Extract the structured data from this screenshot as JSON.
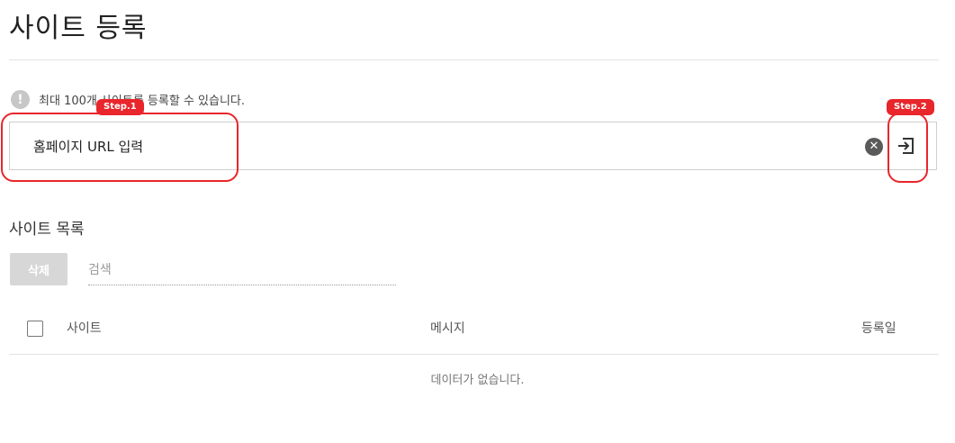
{
  "page": {
    "title": "사이트 등록"
  },
  "notice": {
    "text": "최대 100개 사이트를 등록할 수 있습니다."
  },
  "url_form": {
    "placeholder": "홈페이지 URL 입력",
    "clear_icon": "close-circle-icon",
    "submit_icon": "enter-arrow-icon"
  },
  "callouts": {
    "step1": "Step.1",
    "step2": "Step.2"
  },
  "site_list": {
    "title": "사이트 목록",
    "delete_label": "삭제",
    "search_placeholder": "검색",
    "columns": {
      "site": "사이트",
      "message": "메시지",
      "date": "등록일"
    },
    "empty_text": "데이터가 없습니다."
  },
  "colors": {
    "accent_red": "#e8262b",
    "disabled_button": "#d7d7d7"
  }
}
